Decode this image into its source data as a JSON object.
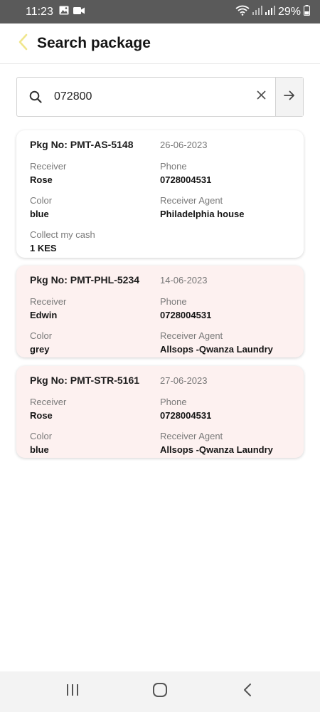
{
  "status_bar": {
    "time": "11:23",
    "battery": "29%",
    "icons": [
      "gallery-icon",
      "video-icon",
      "wifi-icon",
      "signal-icon",
      "signal-icon",
      "battery-icon"
    ]
  },
  "header": {
    "title": "Search package",
    "back_icon": "chevron-left-icon",
    "accent_color": "#f0e68c"
  },
  "search": {
    "value": "072800",
    "icons": [
      "search-icon",
      "close-icon",
      "arrow-right-icon"
    ]
  },
  "results": [
    {
      "pkg_label": "Pkg No: PMT-AS-5148",
      "date": "26-06-2023",
      "receiver_label": "Receiver",
      "receiver": "Rose",
      "phone_label": "Phone",
      "phone": "0728004531",
      "color_label": "Color",
      "color": "blue",
      "agent_label": "Receiver Agent",
      "agent": "Philadelphia house",
      "cash_label": "Collect my cash",
      "cash": "1 KES",
      "highlight": false
    },
    {
      "pkg_label": "Pkg No: PMT-PHL-5234",
      "date": "14-06-2023",
      "receiver_label": "Receiver",
      "receiver": "Edwin",
      "phone_label": "Phone",
      "phone": "0728004531",
      "color_label": "Color",
      "color": "grey",
      "agent_label": "Receiver Agent",
      "agent": "Allsops -Qwanza Laundry",
      "highlight": true
    },
    {
      "pkg_label": "Pkg No: PMT-STR-5161",
      "date": "27-06-2023",
      "receiver_label": "Receiver",
      "receiver": "Rose",
      "phone_label": "Phone",
      "phone": "0728004531",
      "color_label": "Color",
      "color": "blue",
      "agent_label": "Receiver Agent",
      "agent": "Allsops -Qwanza Laundry",
      "highlight": true
    }
  ],
  "nav_bar": {
    "icons": [
      "recent-apps-icon",
      "home-icon",
      "back-icon"
    ]
  }
}
